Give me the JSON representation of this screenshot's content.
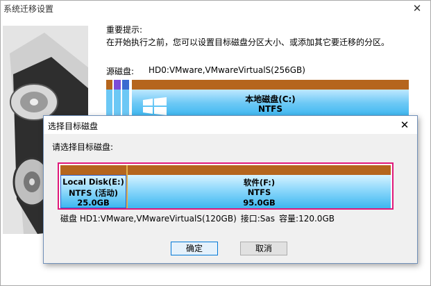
{
  "main_window": {
    "title": "系统迁移设置",
    "close_glyph": "✕"
  },
  "tip": {
    "heading": "重要提示:",
    "text": "在开始执行之前，您可以设置目标磁盘分区大小、或添加其它要迁移的分区。"
  },
  "source": {
    "label": "源磁盘:",
    "disk_name": "HD0:VMware,VMwareVirtualS(256GB)",
    "main_partition": {
      "name": "本地磁盘(C:)",
      "fs": "NTFS"
    },
    "small_partition_colors": [
      "#7b4bd8",
      "#3a6ad0",
      "#1f8a8a"
    ]
  },
  "dialog": {
    "title": "选择目标磁盘",
    "close_glyph": "✕",
    "prompt": "请选择目标磁盘:",
    "partitions": [
      {
        "name": "Local Disk(E:)",
        "fs": "NTFS (活动)",
        "size": "25.0GB"
      },
      {
        "name": "软件(F:)",
        "fs": "NTFS",
        "size": "95.0GB"
      }
    ],
    "disk_info": {
      "disk": "磁盘 HD1:VMware,VMwareVirtualS(120GB)",
      "interface": "接口:Sas",
      "capacity": "容量:120.0GB"
    },
    "buttons": {
      "ok": "确定",
      "cancel": "取消"
    }
  },
  "colors": {
    "partition_top": "#b5651d",
    "selection_border": "#e0187a",
    "partition_fill": "#3cb7f0"
  },
  "icons": [
    "hard-drive-image",
    "windows-logo-icon",
    "close-icon"
  ]
}
